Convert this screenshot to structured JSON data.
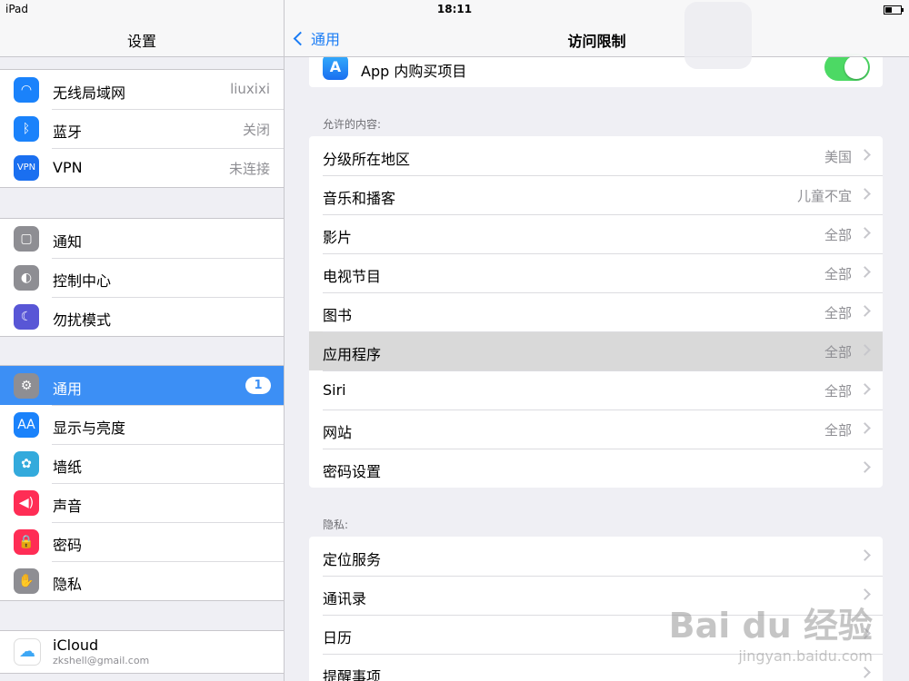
{
  "status": {
    "device": "iPad",
    "time": "18:11"
  },
  "sidebar": {
    "title": "设置",
    "group1": [
      {
        "label": "无线局域网",
        "value": "liuxixi",
        "icon": "wifi-icon",
        "color": "#1a82fb",
        "glyph": "◠"
      },
      {
        "label": "蓝牙",
        "value": "关闭",
        "icon": "bluetooth-icon",
        "color": "#1a82fb",
        "glyph": "ᛒ"
      },
      {
        "label": "VPN",
        "value": "未连接",
        "icon": "vpn-icon",
        "color": "#1a6ff0",
        "glyph": "VPN"
      }
    ],
    "group2": [
      {
        "label": "通知",
        "icon": "notification-icon",
        "color": "#8e8e93",
        "glyph": "▢"
      },
      {
        "label": "控制中心",
        "icon": "control-center-icon",
        "color": "#8e8e93",
        "glyph": "◐"
      },
      {
        "label": "勿扰模式",
        "icon": "moon-icon",
        "color": "#5856d6",
        "glyph": "☾"
      }
    ],
    "group3": [
      {
        "label": "通用",
        "badge": "1",
        "icon": "gear-icon",
        "color": "#8e8e93",
        "glyph": "⚙"
      },
      {
        "label": "显示与亮度",
        "icon": "display-icon",
        "color": "#1a82fb",
        "glyph": "AA"
      },
      {
        "label": "墙纸",
        "icon": "wallpaper-icon",
        "color": "#33aadc",
        "glyph": "✿"
      },
      {
        "label": "声音",
        "icon": "sound-icon",
        "color": "#ff2d55",
        "glyph": "◀)"
      },
      {
        "label": "密码",
        "icon": "lock-icon",
        "color": "#ff2d55",
        "glyph": "🔒"
      },
      {
        "label": "隐私",
        "icon": "hand-icon",
        "color": "#8e8e93",
        "glyph": "✋"
      }
    ],
    "icloud": {
      "label": "iCloud",
      "sub": "zkshell@gmail.com",
      "icon": "icloud-icon",
      "color": "#fff",
      "glyph": "☁"
    }
  },
  "main": {
    "back_label": "通用",
    "title": "访问限制",
    "purchases": {
      "label": "App 内购买项目",
      "on": true
    },
    "content_header": "允许的内容:",
    "content": [
      {
        "label": "分级所在地区",
        "value": "美国"
      },
      {
        "label": "音乐和播客",
        "value": "儿童不宜"
      },
      {
        "label": "影片",
        "value": "全部"
      },
      {
        "label": "电视节目",
        "value": "全部"
      },
      {
        "label": "图书",
        "value": "全部"
      },
      {
        "label": "应用程序",
        "value": "全部",
        "highlighted": true
      },
      {
        "label": "Siri",
        "value": "全部"
      },
      {
        "label": "网站",
        "value": "全部"
      },
      {
        "label": "密码设置",
        "value": ""
      }
    ],
    "privacy_header": "隐私:",
    "privacy": [
      {
        "label": "定位服务"
      },
      {
        "label": "通讯录"
      },
      {
        "label": "日历"
      },
      {
        "label": "提醒事项"
      }
    ]
  },
  "watermark": {
    "text": "Bai du 经验",
    "url": "jingyan.baidu.com"
  }
}
